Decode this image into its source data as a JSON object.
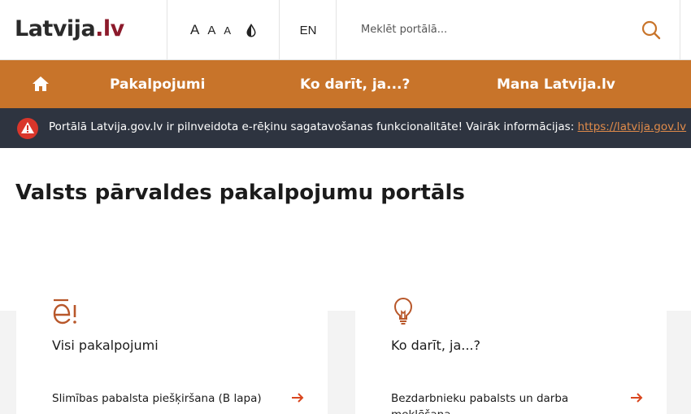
{
  "header": {
    "logo_main": "Latvija",
    "logo_suffix": ".lv",
    "font_size_small": "A",
    "font_size_medium": "A",
    "font_size_large": "A",
    "language": "EN",
    "search_placeholder": "Meklēt portālā..."
  },
  "nav": {
    "items": [
      {
        "label": "Pakalpojumi"
      },
      {
        "label": "Ko darīt, ja...?"
      },
      {
        "label": "Mana Latvija.lv"
      }
    ]
  },
  "alert": {
    "text": "Portālā Latvija.gov.lv ir pilnveidota e-rēķinu sagatavošanas funkcionalitāte! Vairāk informācijas: ",
    "link": "https://latvija.gov.lv"
  },
  "main": {
    "title": "Valsts pārvaldes pakalpojumu portāls",
    "cards": [
      {
        "title": "Visi pakalpojumi",
        "link": "Slimības pabalsta piešķiršana (B lapa)"
      },
      {
        "title": "Ko darīt, ja...?",
        "link": "Bezdarbnieku pabalsts un darba meklēšana"
      }
    ]
  },
  "colors": {
    "accent": "#c8742a",
    "alert_bg": "#2e3440",
    "logo_accent": "#8c1a2b",
    "link_arrow": "#d9461e"
  },
  "icons": [
    "home-icon",
    "warning-icon",
    "search-icon",
    "contrast-icon",
    "e-service-icon",
    "lightbulb-icon",
    "arrow-right-icon"
  ]
}
